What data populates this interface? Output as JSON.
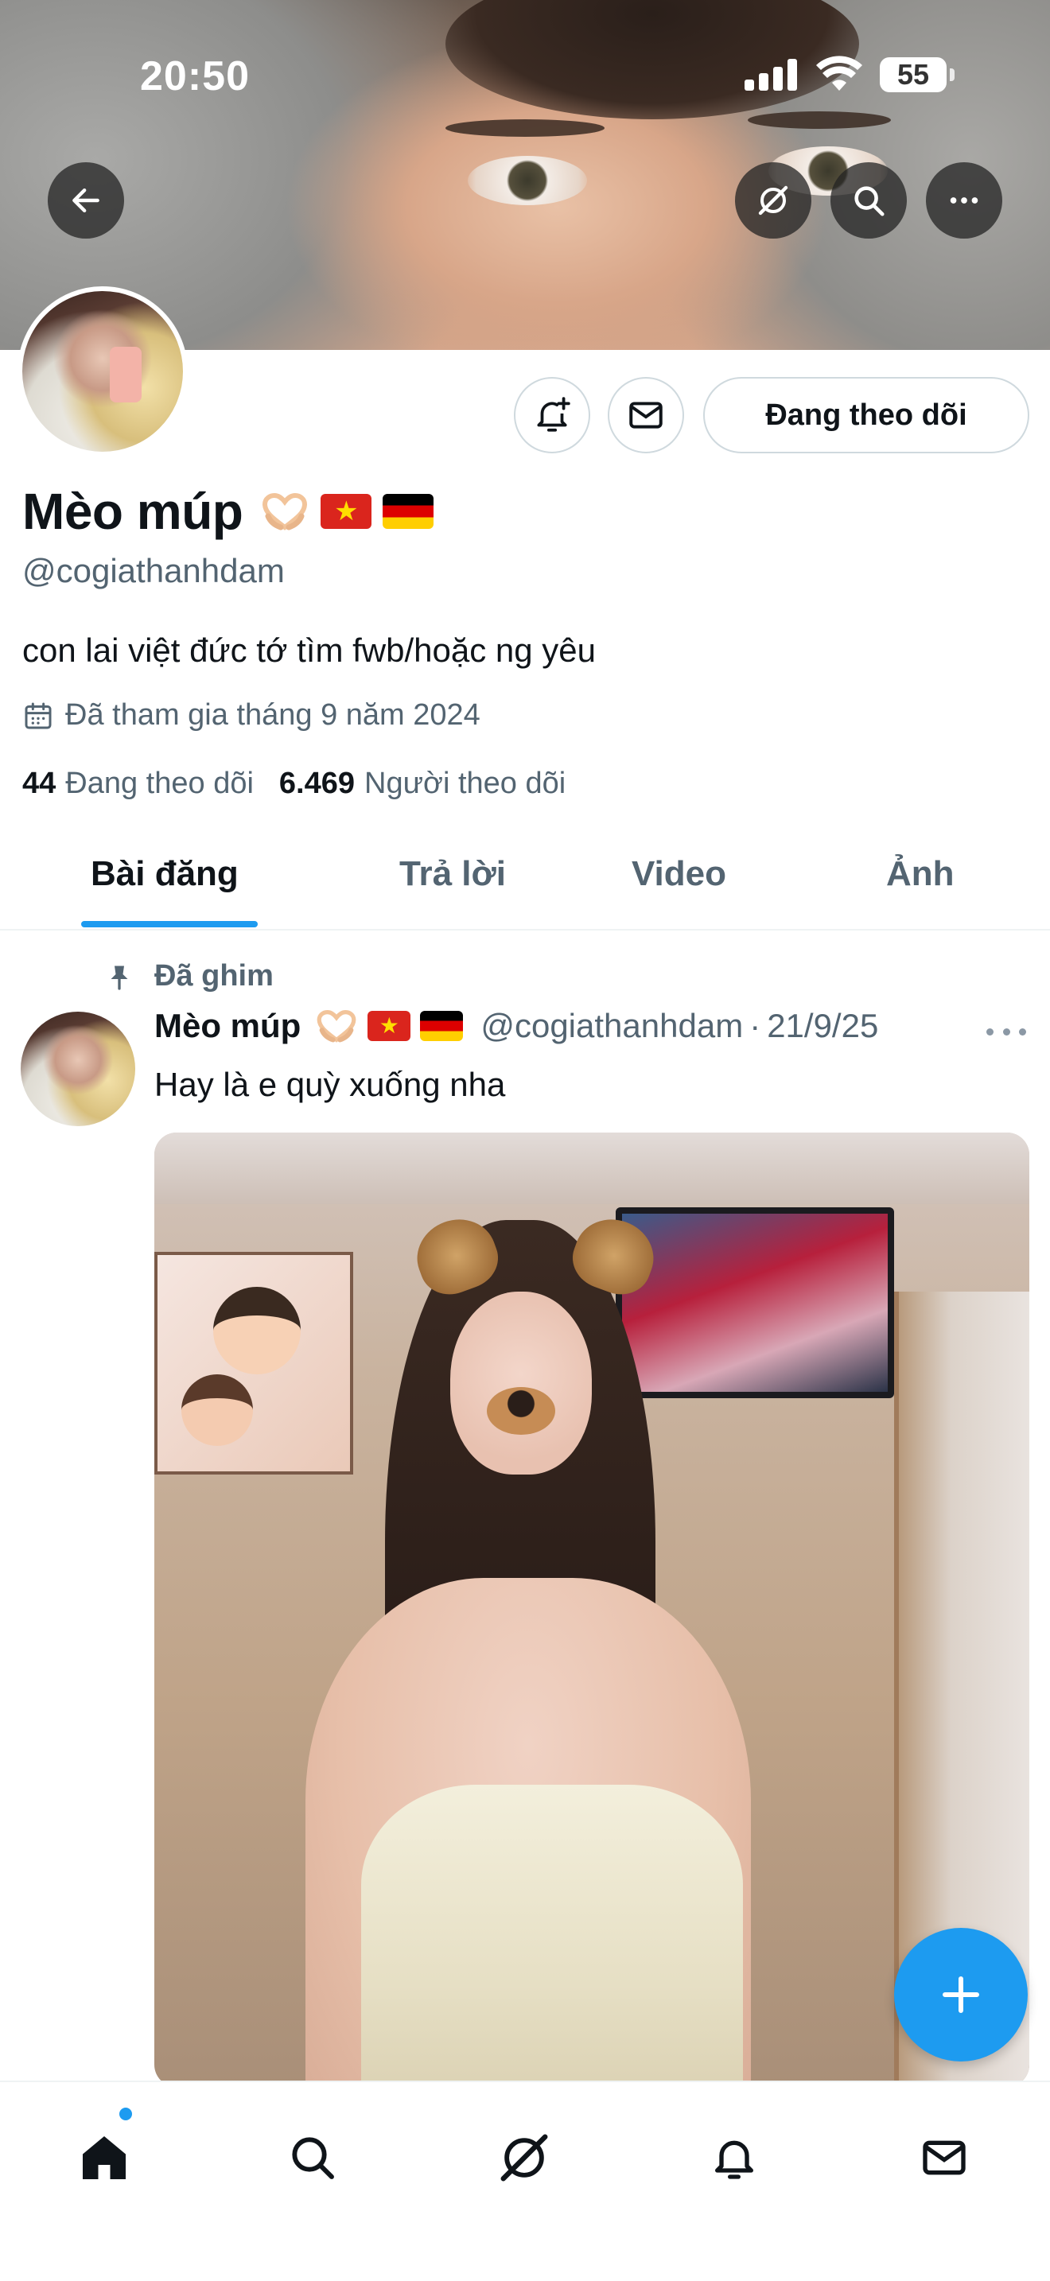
{
  "status_bar": {
    "time": "20:50",
    "battery": "55"
  },
  "profile": {
    "display_name": "Mèo múp",
    "handle": "@cogiathanhdam",
    "bio": "con lai việt đức tớ tìm fwb/hoặc ng yêu",
    "joined": "Đã tham gia tháng 9 năm 2024",
    "following_count": "44",
    "following_label": "Đang theo dõi",
    "followers_count": "6.469",
    "followers_label": "Người theo dõi",
    "follow_button_label": "Đang theo dõi"
  },
  "tabs": [
    {
      "label": "Bài đăng",
      "active": true
    },
    {
      "label": "Trả lời",
      "active": false
    },
    {
      "label": "Video",
      "active": false
    },
    {
      "label": "Ảnh",
      "active": false
    }
  ],
  "pinned_post": {
    "pinned_label": "Đã ghim",
    "author_name": "Mèo múp",
    "author_handle": "@cogiathanhdam",
    "separator": "·",
    "date": "21/9/25",
    "text": "Hay là e quỳ xuống nha"
  },
  "icons": {
    "back": "arrow-left-icon",
    "grok": "grok-icon",
    "search": "search-icon",
    "more": "more-horizontal-icon",
    "notify": "bell-plus-icon",
    "message": "envelope-icon",
    "calendar": "calendar-icon",
    "pin": "pin-icon",
    "compose": "plus-icon",
    "nav": [
      "home-icon",
      "search-icon",
      "grok-icon",
      "bell-icon",
      "envelope-icon"
    ]
  },
  "colors": {
    "accent": "#1d9bf0",
    "text_primary": "#0f1419",
    "text_secondary": "#536471",
    "border": "#cfd9de"
  }
}
